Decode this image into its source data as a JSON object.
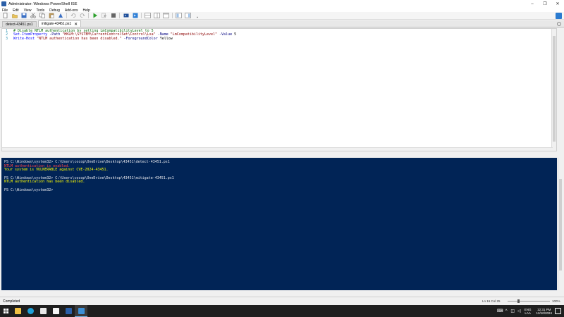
{
  "window": {
    "title": "Administrator: Windows PowerShell ISE",
    "minimize": "–",
    "maximize": "❐",
    "close": "✕"
  },
  "menu": [
    "File",
    "Edit",
    "View",
    "Tools",
    "Debug",
    "Add-ons",
    "Help"
  ],
  "tabs": [
    {
      "label": "detect-43451.ps1",
      "active": false
    },
    {
      "label": "mitigate-43451.ps1",
      "active": true
    }
  ],
  "tab_close": "✕",
  "editor": {
    "lines": [
      {
        "num": "1",
        "comment": "# Disable NTLM authentication by setting LmCompatibilityLevel to 5"
      },
      {
        "num": "2",
        "cmd": "Set-ItemProperty",
        "p1": " -Path ",
        "s1": "\"HKLM:\\SYSTEM\\CurrentControlSet\\Control\\Lsa\"",
        "p2": " -Name ",
        "s2": "\"LmCompatibilityLevel\"",
        "p3": " -Value ",
        "v3": "5"
      },
      {
        "num": "3",
        "cmd": "Write-Host",
        "s1": " \"NTLM authentication has been disabled.\"",
        "p2": " -ForegroundColor ",
        "v2": "Yellow"
      }
    ]
  },
  "console": {
    "lines": [
      {
        "text": "PS C:\\Windows\\system32> C:\\Users\\cocop\\OneDrive\\Desktop\\43451\\detect-43451.ps1",
        "kind": "normal"
      },
      {
        "text": "NTLM authentication is enabled.",
        "kind": "err"
      },
      {
        "text": "Your system is VULNERABLE against CVE-2024-43451.",
        "kind": "warn"
      },
      {
        "text": "",
        "kind": "blank"
      },
      {
        "text": "PS C:\\Windows\\system32> C:\\Users\\cocop\\OneDrive\\Desktop\\43451\\mitigate-43451.ps1",
        "kind": "normal"
      },
      {
        "text": "NTLM authentication has been disabled.",
        "kind": "warn"
      },
      {
        "text": "",
        "kind": "blank"
      },
      {
        "text": "PS C:\\Windows\\system32>",
        "kind": "normal"
      }
    ]
  },
  "status": {
    "text": "Completed",
    "position": "Ln 16  Col 25",
    "zoom": "100%"
  },
  "taskbar": {
    "lang_top": "ENG",
    "lang_bottom": "LAA",
    "time": "12:31 PM",
    "date": "12/10/2024"
  },
  "colors": {
    "console_bg": "#012456",
    "warning": "#ffff00",
    "error": "#ff4444"
  }
}
